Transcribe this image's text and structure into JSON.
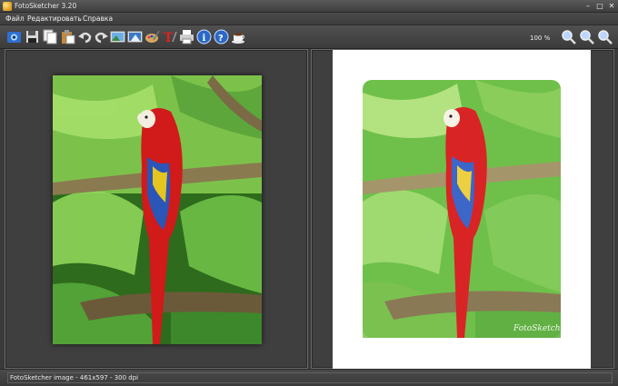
{
  "window": {
    "title": "FotoSketcher 3.20"
  },
  "menu": {
    "items": [
      "Файл",
      "Редактировать",
      "Справка"
    ]
  },
  "toolbar": {
    "tools": [
      "open-image-icon",
      "save-icon",
      "copy-icon",
      "paste-icon",
      "undo-icon",
      "redo-icon",
      "original-image-icon",
      "result-image-icon",
      "painting-parameters-icon",
      "add-text-icon",
      "print-icon",
      "info-icon",
      "help-icon",
      "coffee-icon"
    ],
    "zoom_value": "100 %",
    "zoom_tools": [
      "zoom-in-icon",
      "zoom-out-icon",
      "zoom-fit-icon"
    ]
  },
  "canvas": {
    "signature": "FotoSketcher"
  },
  "status": {
    "text": "FotoSketcher image - 461x597 - 300 dpi"
  },
  "colors": {
    "accent": "#e02020",
    "background": "#3f3f3f",
    "foliage": "#4caf3a"
  }
}
